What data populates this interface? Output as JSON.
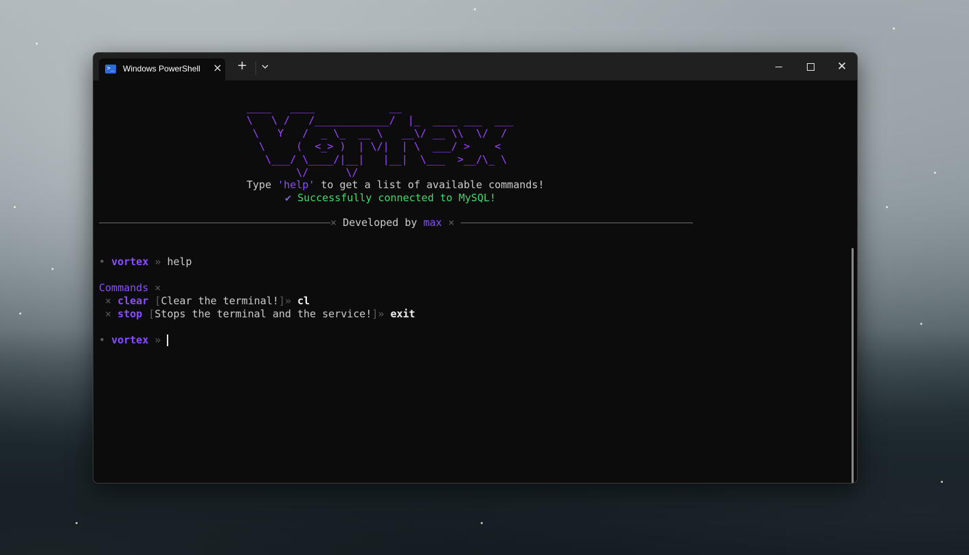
{
  "window": {
    "tab_title": "Windows PowerShell",
    "tab_icon": "powershell-icon",
    "new_tab_label": "+",
    "colors": {
      "accent": "#8a4dff",
      "success": "#42d96b",
      "background": "#0c0c0c",
      "titlebar": "#202020"
    }
  },
  "terminal": {
    "banner_ascii": "____   ____            __\n\\   \\ /   /____________/  |_  ____ ___  ___\n \\   Y   /  _ \\_  __ \\   __\\/ __ \\\\  \\/  /\n  \\     (  <_> )  | \\/|  | \\  ___/ >    <\n   \\___/ \\____/|__|   |__|  \\___  >__/\\_ \\\n        \\/      \\/",
    "hint": {
      "prefix": "Type ",
      "keyword": "'help'",
      "suffix": " to get a list of available commands!"
    },
    "status": {
      "icon": "✔",
      "text": "Successfully connected to MySQL!"
    },
    "divider": {
      "mark_left": "×",
      "text": "Developed by ",
      "author": "max",
      "mark_right": "×"
    },
    "history": [
      {
        "bullet": "•",
        "prompt": "vortex",
        "separator": "»",
        "command": "help"
      }
    ],
    "commands_header": {
      "label": "Commands",
      "mark": "×"
    },
    "commands": [
      {
        "mark": "×",
        "name": "clear",
        "open": "[",
        "description": "Clear the terminal!",
        "close": "]",
        "arrow": "»",
        "alias": "cl"
      },
      {
        "mark": "×",
        "name": "stop",
        "open": "[",
        "description": "Stops the terminal and the service!",
        "close": "]",
        "arrow": "»",
        "alias": "exit"
      }
    ],
    "current_prompt": {
      "bullet": "•",
      "prompt": "vortex",
      "separator": "»",
      "input": ""
    }
  }
}
